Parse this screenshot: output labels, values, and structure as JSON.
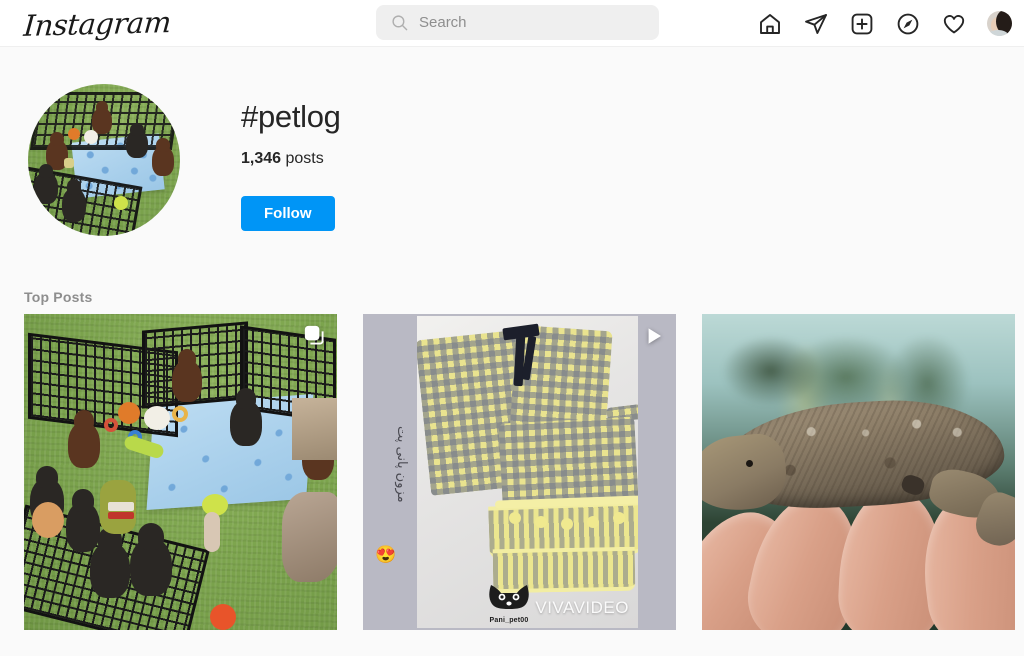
{
  "header": {
    "logo": "Instagram",
    "search": {
      "placeholder": "Search",
      "value": "",
      "icon": "search-icon"
    },
    "nav": [
      {
        "name": "home-icon",
        "label": "Home"
      },
      {
        "name": "messenger-icon",
        "label": "Messenger"
      },
      {
        "name": "new-post-icon",
        "label": "New post"
      },
      {
        "name": "explore-icon",
        "label": "Explore"
      },
      {
        "name": "activity-icon",
        "label": "Activity"
      },
      {
        "name": "profile-avatar",
        "label": "Profile"
      }
    ]
  },
  "hashtag": {
    "avatar_alt": "Labrador puppies in a playpen on artificial grass with a blue paw-print mat",
    "title": "#petlog",
    "post_count": "1,346",
    "post_count_label": "posts",
    "follow_label": "Follow"
  },
  "section": {
    "top_posts_label": "Top Posts"
  },
  "posts": [
    {
      "alt": "Black and chocolate Labrador puppies in a black wire playpen on green turf with toys and a blue paw-print mat",
      "badge": "carousel-icon",
      "badge_label": "Multiple photos"
    },
    {
      "alt": "Yellow and grey gingham pet outfit with black bow and pom-pom ruffled skirt on a white blanket",
      "badge": "play-icon",
      "badge_label": "Video",
      "overlay_text": "مزون پانی پت",
      "overlay_emoji": "😍",
      "watermark": "VIVAVIDEO",
      "logo_name": "Pani_pet00"
    },
    {
      "alt": "A brown and tan gargoyle gecko resting on a person's fingers in front of a blurred terrarium",
      "badge": null,
      "badge_label": null
    }
  ],
  "colors": {
    "brand_blue": "#0095f6",
    "text_primary": "#262626",
    "text_secondary": "#8e8e8e",
    "page_bg": "#fafafa",
    "header_bg": "#ffffff",
    "search_bg": "#efefef",
    "border": "#efefef"
  }
}
